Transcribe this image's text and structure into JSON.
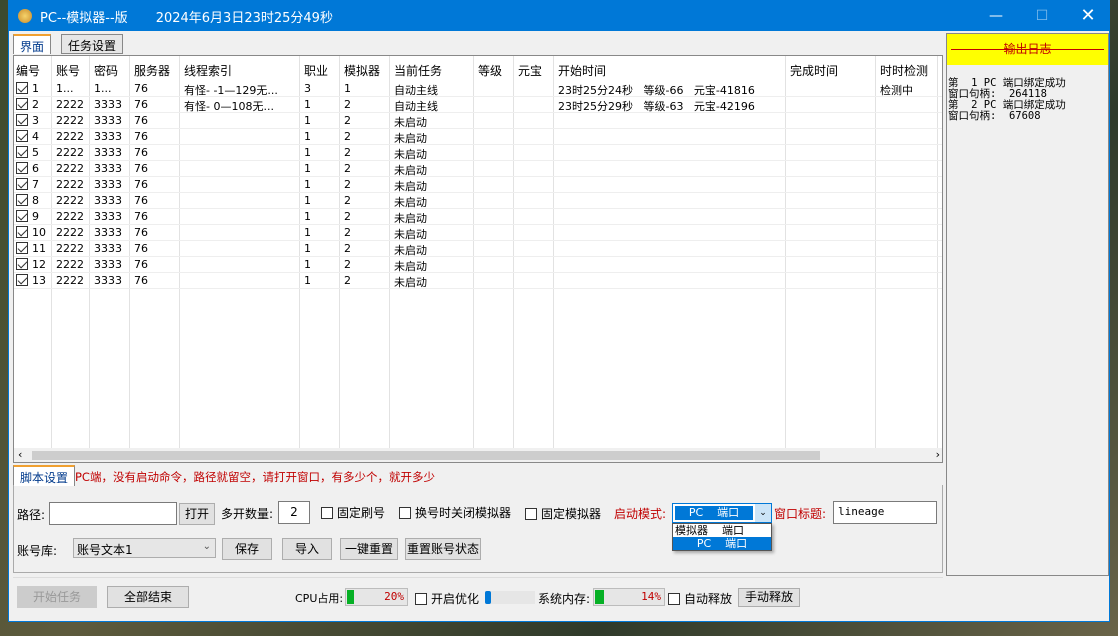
{
  "window": {
    "title": "PC--模拟器--版",
    "datetime": "2024年6月3日23时25分49秒"
  },
  "tabs": [
    "界面",
    "任务设置"
  ],
  "table": {
    "columns": [
      "编号",
      "账号",
      "密码",
      "服务器",
      "线程索引",
      "职业",
      "模拟器",
      "当前任务",
      "等级",
      "元宝",
      "开始时间",
      "完成时间",
      "时时检测"
    ],
    "rows": [
      {
        "checked": true,
        "id": "1",
        "account": "1...",
        "password": "1...",
        "server": "76",
        "thread": "有怪- -1—129无...",
        "job": "3",
        "emu": "1",
        "task": "自动主线",
        "level": "",
        "yuanbao": "",
        "start": "23时25分24秒   等级-66   元宝-41816",
        "finish": "",
        "check": "检测中"
      },
      {
        "checked": true,
        "id": "2",
        "account": "2222",
        "password": "3333",
        "server": "76",
        "thread": "有怪- 0—108无...",
        "job": "1",
        "emu": "2",
        "task": "自动主线",
        "level": "",
        "yuanbao": "",
        "start": "23时25分29秒   等级-63   元宝-42196",
        "finish": "",
        "check": ""
      },
      {
        "checked": true,
        "id": "3",
        "account": "2222",
        "password": "3333",
        "server": "76",
        "thread": "",
        "job": "1",
        "emu": "2",
        "task": "未启动",
        "level": "",
        "yuanbao": "",
        "start": "",
        "finish": "",
        "check": ""
      },
      {
        "checked": true,
        "id": "4",
        "account": "2222",
        "password": "3333",
        "server": "76",
        "thread": "",
        "job": "1",
        "emu": "2",
        "task": "未启动",
        "level": "",
        "yuanbao": "",
        "start": "",
        "finish": "",
        "check": ""
      },
      {
        "checked": true,
        "id": "5",
        "account": "2222",
        "password": "3333",
        "server": "76",
        "thread": "",
        "job": "1",
        "emu": "2",
        "task": "未启动",
        "level": "",
        "yuanbao": "",
        "start": "",
        "finish": "",
        "check": ""
      },
      {
        "checked": true,
        "id": "6",
        "account": "2222",
        "password": "3333",
        "server": "76",
        "thread": "",
        "job": "1",
        "emu": "2",
        "task": "未启动",
        "level": "",
        "yuanbao": "",
        "start": "",
        "finish": "",
        "check": ""
      },
      {
        "checked": true,
        "id": "7",
        "account": "2222",
        "password": "3333",
        "server": "76",
        "thread": "",
        "job": "1",
        "emu": "2",
        "task": "未启动",
        "level": "",
        "yuanbao": "",
        "start": "",
        "finish": "",
        "check": ""
      },
      {
        "checked": true,
        "id": "8",
        "account": "2222",
        "password": "3333",
        "server": "76",
        "thread": "",
        "job": "1",
        "emu": "2",
        "task": "未启动",
        "level": "",
        "yuanbao": "",
        "start": "",
        "finish": "",
        "check": ""
      },
      {
        "checked": true,
        "id": "9",
        "account": "2222",
        "password": "3333",
        "server": "76",
        "thread": "",
        "job": "1",
        "emu": "2",
        "task": "未启动",
        "level": "",
        "yuanbao": "",
        "start": "",
        "finish": "",
        "check": ""
      },
      {
        "checked": true,
        "id": "10",
        "account": "2222",
        "password": "3333",
        "server": "76",
        "thread": "",
        "job": "1",
        "emu": "2",
        "task": "未启动",
        "level": "",
        "yuanbao": "",
        "start": "",
        "finish": "",
        "check": ""
      },
      {
        "checked": true,
        "id": "11",
        "account": "2222",
        "password": "3333",
        "server": "76",
        "thread": "",
        "job": "1",
        "emu": "2",
        "task": "未启动",
        "level": "",
        "yuanbao": "",
        "start": "",
        "finish": "",
        "check": ""
      },
      {
        "checked": true,
        "id": "12",
        "account": "2222",
        "password": "3333",
        "server": "76",
        "thread": "",
        "job": "1",
        "emu": "2",
        "task": "未启动",
        "level": "",
        "yuanbao": "",
        "start": "",
        "finish": "",
        "check": ""
      },
      {
        "checked": true,
        "id": "13",
        "account": "2222",
        "password": "3333",
        "server": "76",
        "thread": "",
        "job": "1",
        "emu": "2",
        "task": "未启动",
        "level": "",
        "yuanbao": "",
        "start": "",
        "finish": "",
        "check": ""
      }
    ]
  },
  "log": {
    "title": "输出日志",
    "text": "第  1 PC 端口绑定成功\n窗口句柄:  264118\n第  2 PC 端口绑定成功\n窗口句柄:  67608"
  },
  "script": {
    "tab": "脚本设置",
    "hint": "PC端，没有启动命令，路径就留空，请打开窗口，有多少个，就开多少",
    "path_label": "路径:",
    "path_value": "",
    "open": "打开",
    "count_label": "多开数量:",
    "count_value": "2",
    "fixed_account": "固定刷号",
    "close_emu": "换号时关闭模拟器",
    "fixed_emu": "固定模拟器",
    "mode_label": "启动模式:",
    "mode_value": "PC    端口",
    "mode_options": [
      "模拟器    端口",
      "PC    端口"
    ],
    "wintitle_label": "窗口标题:",
    "wintitle_value": "lineage",
    "lib_label": "账号库:",
    "lib_value": "账号文本1",
    "save": "保存",
    "import": "导入",
    "reset_all": "一键重置",
    "reset_status": "重置账号状态"
  },
  "footer": {
    "start": "开始任务",
    "end_all": "全部结束",
    "cpu_label": "CPU占用:",
    "cpu": 20,
    "cpu_text": "20%",
    "optimize": "开启优化",
    "mem_label": "系统内存:",
    "mem": 14,
    "mem_text": "14%",
    "auto_release": "自动释放",
    "manual_release": "手动释放"
  }
}
